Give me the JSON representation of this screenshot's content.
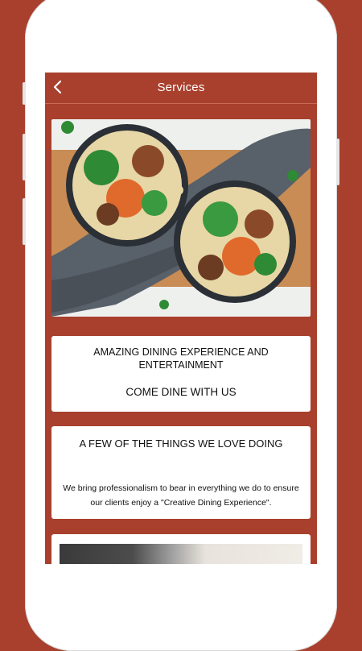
{
  "header": {
    "title": "Services",
    "back_icon": "chevron-left-icon"
  },
  "hero": {
    "alt": "food bowls"
  },
  "cards": [
    {
      "heading": "AMAZING DINING EXPERIENCE AND ENTERTAINMENT",
      "subheading": "COME DINE WITH US"
    },
    {
      "heading": "A FEW OF THE THINGS WE LOVE DOING",
      "body": "We bring professionalism to bear in everything we do to ensure our clients enjoy a \"Creative Dining Experience\"."
    }
  ],
  "colors": {
    "brand": "#a8402d",
    "card": "#ffffff"
  }
}
